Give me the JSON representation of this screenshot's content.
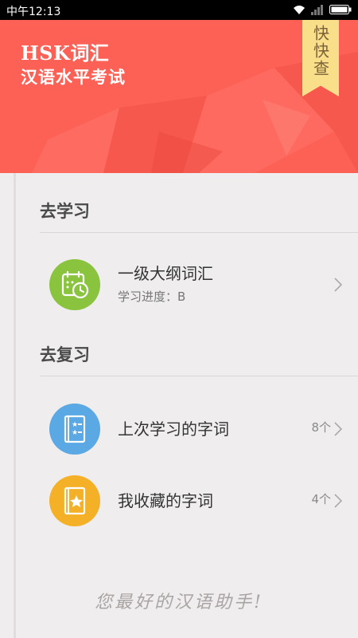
{
  "status_bar": {
    "time": "中午12:13"
  },
  "header": {
    "title_line1": "HSK词汇",
    "title_line2": "汉语水平考试",
    "ribbon_label": "快快查",
    "background_color": "#fd6055",
    "ribbon_color": "#f9df8a"
  },
  "sections": [
    {
      "title": "去学习",
      "items": [
        {
          "title": "一级大纲词汇",
          "subtitle": "学习进度：B",
          "icon": "calendar-clock-icon",
          "icon_color": "#8ac43f"
        }
      ]
    },
    {
      "title": "去复习",
      "items": [
        {
          "title": "上次学习的字词",
          "count": "8个",
          "icon": "star-list-book-icon",
          "icon_color": "#5aa8e4"
        },
        {
          "title": "我收藏的字词",
          "count": "4个",
          "icon": "star-book-icon",
          "icon_color": "#f4b128"
        }
      ]
    }
  ],
  "slogan": "您最好的汉语助手!"
}
